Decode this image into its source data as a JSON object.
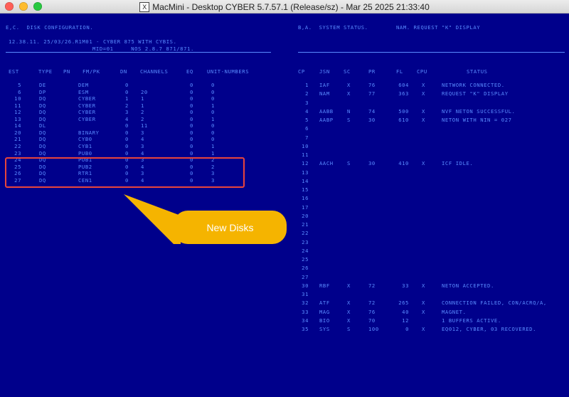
{
  "window": {
    "title": "MacMini - Desktop CYBER 5.7.57.1 (Release/sz) - Mar 25 2025 21:33:40",
    "x_icon": "X",
    "traffic_lights": {
      "close": "#ff5f57",
      "minimize": "#febc2e",
      "zoom": "#28c840"
    }
  },
  "left": {
    "header": "E,C.  DISK CONFIGURATION.",
    "line1": "12.38.11. 25/03/26.R1M01 - CYBER 875 WITH CYBIS.",
    "line2": "MID=01     NOS 2.8.7 871/871.",
    "columns": {
      "est": "EST",
      "type": "TYPE",
      "pn": "PN",
      "fmpk": "FM/PK",
      "dn": "DN",
      "channels": "CHANNELS",
      "eq": "EQ",
      "unit": "UNIT-NUMBERS"
    },
    "rows": [
      {
        "est": "5",
        "type": "DE",
        "fm": "DEM",
        "dn": "0",
        "ch": "",
        "eq": "0",
        "unit": "0"
      },
      {
        "est": "6",
        "type": "DP",
        "fm": "ESM",
        "dn": "0",
        "ch": "20",
        "eq": "0",
        "unit": "0"
      },
      {
        "est": "10",
        "type": "DQ",
        "fm": "CYBER",
        "dn": "1",
        "ch": "1",
        "eq": "0",
        "unit": "0"
      },
      {
        "est": "11",
        "type": "DQ",
        "fm": "CYBER",
        "dn": "2",
        "ch": "1",
        "eq": "0",
        "unit": "1"
      },
      {
        "est": "12",
        "type": "DQ",
        "fm": "CYBER",
        "dn": "3",
        "ch": "2",
        "eq": "0",
        "unit": "0"
      },
      {
        "est": "13",
        "type": "DQ",
        "fm": "CYBER",
        "dn": "4",
        "ch": "2",
        "eq": "0",
        "unit": "1"
      },
      {
        "est": "14",
        "type": "DL",
        "fm": "",
        "dn": "0",
        "ch": "11",
        "eq": "0",
        "unit": "0"
      },
      {
        "est": "20",
        "type": "DQ",
        "fm": "BINARY",
        "dn": "0",
        "ch": "3",
        "eq": "0",
        "unit": "0"
      },
      {
        "est": "21",
        "type": "DQ",
        "fm": "CYB0",
        "dn": "0",
        "ch": "4",
        "eq": "0",
        "unit": "0"
      },
      {
        "est": "22",
        "type": "DQ",
        "fm": "CYB1",
        "dn": "0",
        "ch": "3",
        "eq": "0",
        "unit": "1"
      },
      {
        "est": "23",
        "type": "DQ",
        "fm": "PUB0",
        "dn": "0",
        "ch": "4",
        "eq": "0",
        "unit": "1"
      },
      {
        "est": "24",
        "type": "DQ",
        "fm": "PUB1",
        "dn": "0",
        "ch": "3",
        "eq": "0",
        "unit": "2"
      },
      {
        "est": "25",
        "type": "DQ",
        "fm": "PUB2",
        "dn": "0",
        "ch": "4",
        "eq": "0",
        "unit": "2"
      },
      {
        "est": "26",
        "type": "DQ",
        "fm": "RTR1",
        "dn": "0",
        "ch": "3",
        "eq": "0",
        "unit": "3"
      },
      {
        "est": "27",
        "type": "DQ",
        "fm": "CEN1",
        "dn": "0",
        "ch": "4",
        "eq": "0",
        "unit": "3"
      }
    ]
  },
  "right": {
    "header": "B,A.  SYSTEM STATUS.        NAM. REQUEST \"K\" DISPLAY",
    "columns": {
      "cp": "CP",
      "jsn": "JSN",
      "sc": "SC",
      "pr": "PR",
      "fl": "FL",
      "cpu": "CPU",
      "status": "STATUS"
    },
    "rows": [
      {
        "cp": "1",
        "jsn": "IAF",
        "sc": "X",
        "pr": "76",
        "fl": "604",
        "cpu": "X",
        "status": "NETWORK CONNECTED."
      },
      {
        "cp": "2",
        "jsn": "NAM",
        "sc": "X",
        "pr": "77",
        "fl": "363",
        "cpu": "X",
        "status": "REQUEST \"K\" DISPLAY"
      },
      {
        "cp": "3",
        "jsn": "",
        "sc": "",
        "pr": "",
        "fl": "",
        "cpu": "",
        "status": ""
      },
      {
        "cp": "4",
        "jsn": "AABB",
        "sc": "N",
        "pr": "74",
        "fl": "500",
        "cpu": "X",
        "status": "NVF NETON SUCCESSFUL."
      },
      {
        "cp": "5",
        "jsn": "AABP",
        "sc": "S",
        "pr": "30",
        "fl": "610",
        "cpu": "X",
        "status": "NETON WITH NIN = 027"
      },
      {
        "cp": "6",
        "jsn": "",
        "sc": "",
        "pr": "",
        "fl": "",
        "cpu": "",
        "status": ""
      },
      {
        "cp": "7",
        "jsn": "",
        "sc": "",
        "pr": "",
        "fl": "",
        "cpu": "",
        "status": ""
      },
      {
        "cp": "10",
        "jsn": "",
        "sc": "",
        "pr": "",
        "fl": "",
        "cpu": "",
        "status": ""
      },
      {
        "cp": "11",
        "jsn": "",
        "sc": "",
        "pr": "",
        "fl": "",
        "cpu": "",
        "status": ""
      },
      {
        "cp": "12",
        "jsn": "AACH",
        "sc": "S",
        "pr": "30",
        "fl": "410",
        "cpu": "X",
        "status": "ICF IDLE."
      },
      {
        "cp": "13",
        "jsn": "",
        "sc": "",
        "pr": "",
        "fl": "",
        "cpu": "",
        "status": ""
      },
      {
        "cp": "14",
        "jsn": "",
        "sc": "",
        "pr": "",
        "fl": "",
        "cpu": "",
        "status": ""
      },
      {
        "cp": "15",
        "jsn": "",
        "sc": "",
        "pr": "",
        "fl": "",
        "cpu": "",
        "status": ""
      },
      {
        "cp": "16",
        "jsn": "",
        "sc": "",
        "pr": "",
        "fl": "",
        "cpu": "",
        "status": ""
      },
      {
        "cp": "17",
        "jsn": "",
        "sc": "",
        "pr": "",
        "fl": "",
        "cpu": "",
        "status": ""
      },
      {
        "cp": "20",
        "jsn": "",
        "sc": "",
        "pr": "",
        "fl": "",
        "cpu": "",
        "status": ""
      },
      {
        "cp": "21",
        "jsn": "",
        "sc": "",
        "pr": "",
        "fl": "",
        "cpu": "",
        "status": ""
      },
      {
        "cp": "22",
        "jsn": "",
        "sc": "",
        "pr": "",
        "fl": "",
        "cpu": "",
        "status": ""
      },
      {
        "cp": "23",
        "jsn": "",
        "sc": "",
        "pr": "",
        "fl": "",
        "cpu": "",
        "status": ""
      },
      {
        "cp": "24",
        "jsn": "",
        "sc": "",
        "pr": "",
        "fl": "",
        "cpu": "",
        "status": ""
      },
      {
        "cp": "25",
        "jsn": "",
        "sc": "",
        "pr": "",
        "fl": "",
        "cpu": "",
        "status": ""
      },
      {
        "cp": "26",
        "jsn": "",
        "sc": "",
        "pr": "",
        "fl": "",
        "cpu": "",
        "status": ""
      },
      {
        "cp": "27",
        "jsn": "",
        "sc": "",
        "pr": "",
        "fl": "",
        "cpu": "",
        "status": ""
      },
      {
        "cp": "30",
        "jsn": "RBF",
        "sc": "X",
        "pr": "72",
        "fl": "33",
        "cpu": "X",
        "status": "NETON ACCEPTED."
      },
      {
        "cp": "31",
        "jsn": "",
        "sc": "",
        "pr": "",
        "fl": "",
        "cpu": "",
        "status": ""
      },
      {
        "cp": "32",
        "jsn": "ATF",
        "sc": "X",
        "pr": "72",
        "fl": "265",
        "cpu": "X",
        "status": "CONNECTION FAILED, CON/ACRQ/A,"
      },
      {
        "cp": "33",
        "jsn": "MAG",
        "sc": "X",
        "pr": "76",
        "fl": "40",
        "cpu": "X",
        "status": "MAGNET."
      },
      {
        "cp": "34",
        "jsn": "BIO",
        "sc": "X",
        "pr": "70",
        "fl": "12",
        "cpu": "",
        "status": "1 BUFFERS ACTIVE."
      },
      {
        "cp": "35",
        "jsn": "SYS",
        "sc": "S",
        "pr": "100",
        "fl": "0",
        "cpu": "X",
        "status": "EQ012, CYBER, 03 RECOVERED."
      }
    ]
  },
  "annotation": {
    "label": "New Disks",
    "color": "#f5b400",
    "outline": "#e8453c"
  },
  "colors": {
    "background": "#00008b",
    "text": "#5a8cff"
  }
}
